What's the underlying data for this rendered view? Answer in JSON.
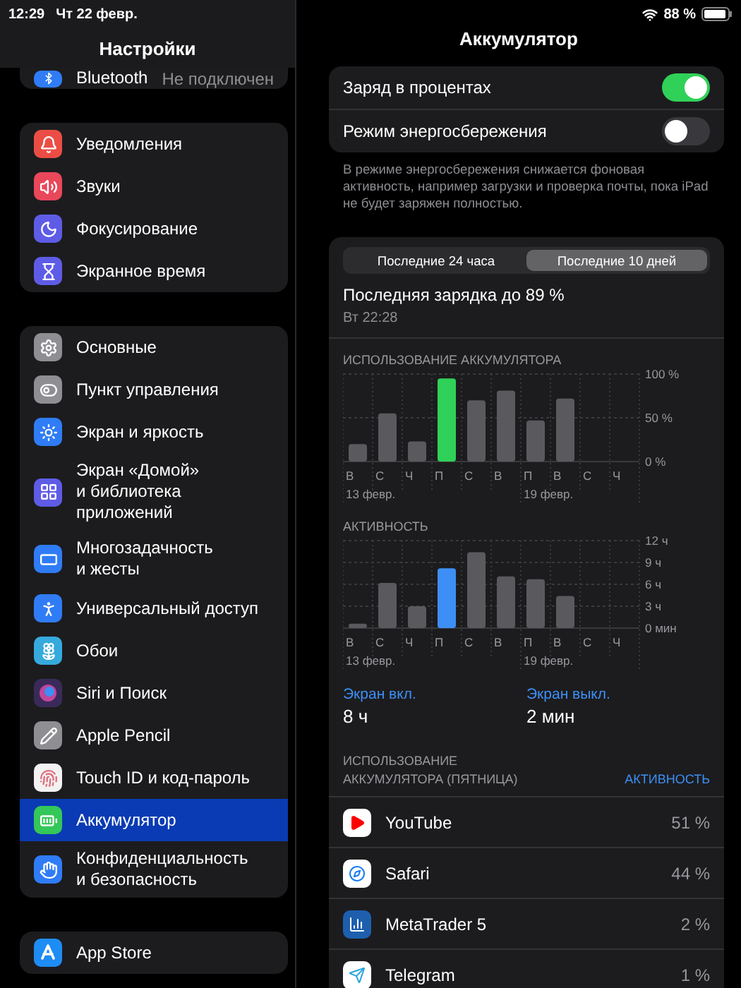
{
  "status_bar": {
    "time": "12:29",
    "date": "Чт 22 февр.",
    "battery_text": "88 %"
  },
  "sidebar": {
    "title": "Настройки",
    "groups": [
      {
        "items": [
          {
            "label": "Bluetooth",
            "value": "Не подключен",
            "color": "#2f7cf6",
            "selected": false
          }
        ]
      },
      {
        "items": [
          {
            "label": "Уведомления",
            "color": "#eb4d45",
            "selected": false
          },
          {
            "label": "Звуки",
            "color": "#e9475a",
            "selected": false
          },
          {
            "label": "Фокусирование",
            "color": "#5e5ce6",
            "selected": false
          },
          {
            "label": "Экранное время",
            "color": "#5e5ce6",
            "selected": false
          }
        ]
      },
      {
        "items": [
          {
            "label": "Основные",
            "color": "#8e8e93",
            "selected": false
          },
          {
            "label": "Пункт управления",
            "color": "#8e8e93",
            "selected": false
          },
          {
            "label": "Экран и яркость",
            "color": "#2f7cf6",
            "selected": false
          },
          {
            "label": "Экран «Домой»\nи библиотека\nприложений",
            "color": "#5e5ce6",
            "selected": false
          },
          {
            "label": "Многозадачность\nи жесты",
            "color": "#2f7cf6",
            "selected": false
          },
          {
            "label": "Универсальный доступ",
            "color": "#2f7cf6",
            "selected": false
          },
          {
            "label": "Обои",
            "color": "#36aadc",
            "selected": false
          },
          {
            "label": "Siri и Поиск",
            "color": "#3a2a5a",
            "selected": false
          },
          {
            "label": "Apple Pencil",
            "color": "#8e8e93",
            "selected": false
          },
          {
            "label": "Touch ID и код-пароль",
            "color": "#f2f2f2",
            "selected": false
          },
          {
            "label": "Аккумулятор",
            "color": "#34c759",
            "selected": true
          },
          {
            "label": "Конфиденциальность\nи безопасность",
            "color": "#2f7cf6",
            "selected": false
          }
        ]
      },
      {
        "items": [
          {
            "label": "App Store",
            "color": "#1e8cf5",
            "selected": false
          }
        ]
      }
    ]
  },
  "detail": {
    "title": "Аккумулятор",
    "toggles": [
      {
        "label": "Заряд в процентах",
        "on": true
      },
      {
        "label": "Режим энергосбережения",
        "on": false
      }
    ],
    "footnote": "В режиме энергосбережения снижается фоновая активность, например загрузки и проверка почты, пока iPad не будет заряжен полностью.",
    "tabs": [
      {
        "label": "Последние 24 часа",
        "selected": false
      },
      {
        "label": "Последние 10 дней",
        "selected": true
      }
    ],
    "last_charge": {
      "title": "Последняя зарядка до 89 %",
      "time": "Вт 22:28"
    },
    "charts": [
      {
        "title": "ИСПОЛЬЗОВАНИЕ АККУМУЛЯТОРА",
        "dates": [
          "13 февр.",
          "19 февр."
        ],
        "chart_data": {
          "type": "bar",
          "stacked": true,
          "grid": true,
          "categories": [
            "В",
            "С",
            "Ч",
            "П",
            "С",
            "В",
            "П",
            "В",
            "С",
            "Ч"
          ],
          "series": [
            {
              "color": "#5a5a5e",
              "values": [
                20,
                55,
                23,
                null,
                70,
                81,
                47,
                72,
                null,
                null
              ]
            },
            {
              "color": "#30d158",
              "values": [
                null,
                null,
                null,
                95,
                null,
                null,
                null,
                null,
                null,
                null
              ]
            }
          ],
          "ylim": [
            0,
            100
          ],
          "yticks": [
            {
              "value": 0,
              "label": "0 %"
            },
            {
              "value": 50,
              "label": "50 %"
            },
            {
              "value": 100,
              "label": "100 %"
            }
          ]
        }
      },
      {
        "title": "АКТИВНОСТЬ",
        "dates": [
          "13 февр.",
          "19 февр."
        ],
        "chart_data": {
          "type": "bar",
          "stacked": true,
          "grid": true,
          "categories": [
            "В",
            "С",
            "Ч",
            "П",
            "С",
            "В",
            "П",
            "В",
            "С",
            "Ч"
          ],
          "series": [
            {
              "color": "#5a5a5e",
              "values": [
                0.6,
                6.2,
                3.0,
                null,
                10.4,
                7.1,
                6.7,
                4.4,
                null,
                null
              ]
            },
            {
              "color": "#3d8ff5",
              "values": [
                null,
                null,
                null,
                8.2,
                null,
                null,
                null,
                null,
                null,
                null
              ]
            }
          ],
          "ylim": [
            0,
            12
          ],
          "yticks": [
            {
              "value": 0,
              "label": "0 мин"
            },
            {
              "value": 3,
              "label": "3 ч"
            },
            {
              "value": 6,
              "label": "6 ч"
            },
            {
              "value": 9,
              "label": "9 ч"
            },
            {
              "value": 12,
              "label": "12 ч"
            }
          ]
        }
      }
    ],
    "screen": [
      {
        "label": "Экран вкл.",
        "value": "8 ч"
      },
      {
        "label": "Экран выкл.",
        "value": "2 мин"
      }
    ],
    "usage_header": {
      "title": "ИСПОЛЬЗОВАНИЕ\nАККУМУЛЯТОРА (ПЯТНИЦА)",
      "link": "АКТИВНОСТЬ"
    },
    "apps": [
      {
        "name": "YouTube",
        "percent": "51 %"
      },
      {
        "name": "Safari",
        "percent": "44 %"
      },
      {
        "name": "MetaTrader 5",
        "percent": "2 %"
      },
      {
        "name": "Telegram",
        "percent": "1 %"
      }
    ]
  }
}
